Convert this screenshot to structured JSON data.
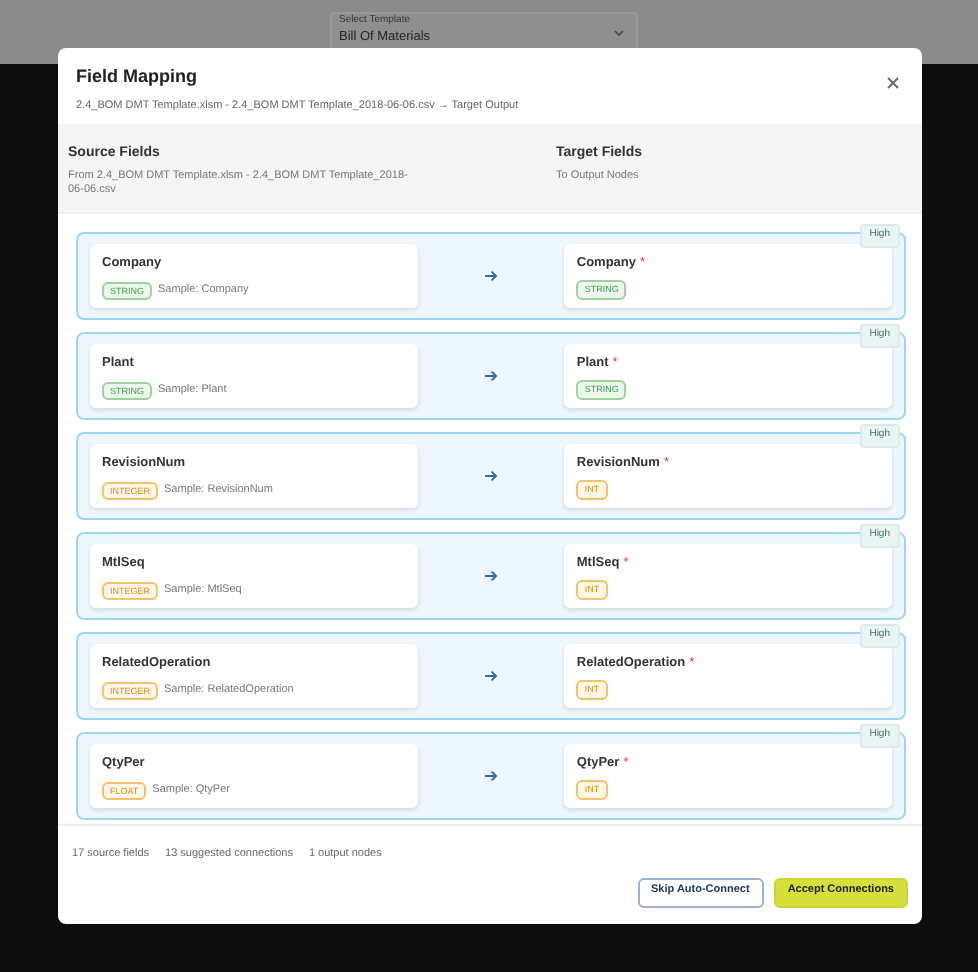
{
  "template_select": {
    "label": "Select Template",
    "value": "Bill Of Materials"
  },
  "modal": {
    "title": "Field Mapping",
    "subtitle": "2.4_BOM DMT Template.xlsm - 2.4_BOM DMT Template_2018-06-06.csv → Target Output",
    "source_header": {
      "title": "Source Fields",
      "description": "From 2.4_BOM DMT Template.xlsm - 2.4_BOM DMT Template_2018-06-06.csv"
    },
    "target_header": {
      "title": "Target Fields",
      "description": "To Output Nodes"
    },
    "mappings": [
      {
        "confidence": "High",
        "source": {
          "name": "Company",
          "type": {
            "text": "STRING",
            "kind": "text"
          },
          "sample": "Sample: Company"
        },
        "target": {
          "name": "Company",
          "required": true,
          "type": {
            "text": "STRING",
            "kind": "text"
          }
        }
      },
      {
        "confidence": "High",
        "source": {
          "name": "Plant",
          "type": {
            "text": "STRING",
            "kind": "text"
          },
          "sample": "Sample: Plant"
        },
        "target": {
          "name": "Plant",
          "required": true,
          "type": {
            "text": "STRING",
            "kind": "text"
          }
        }
      },
      {
        "confidence": "High",
        "source": {
          "name": "RevisionNum",
          "type": {
            "text": "INTEGER",
            "kind": "number"
          },
          "sample": "Sample: RevisionNum"
        },
        "target": {
          "name": "RevisionNum",
          "required": true,
          "type": {
            "text": "INT",
            "kind": "number"
          }
        }
      },
      {
        "confidence": "High",
        "source": {
          "name": "MtlSeq",
          "type": {
            "text": "INTEGER",
            "kind": "number"
          },
          "sample": "Sample: MtlSeq"
        },
        "target": {
          "name": "MtlSeq",
          "required": true,
          "type": {
            "text": "INT",
            "kind": "number"
          }
        }
      },
      {
        "confidence": "High",
        "source": {
          "name": "RelatedOperation",
          "type": {
            "text": "INTEGER",
            "kind": "number"
          },
          "sample": "Sample: RelatedOperation"
        },
        "target": {
          "name": "RelatedOperation",
          "required": true,
          "type": {
            "text": "INT",
            "kind": "number"
          }
        }
      },
      {
        "confidence": "High",
        "source": {
          "name": "QtyPer",
          "type": {
            "text": "FLOAT",
            "kind": "number"
          },
          "sample": "Sample: QtyPer"
        },
        "target": {
          "name": "QtyPer",
          "required": true,
          "type": {
            "text": "INT",
            "kind": "number"
          }
        }
      }
    ],
    "required_mark": "*",
    "stats": [
      "17 source fields",
      "13 suggested connections",
      "1 output nodes"
    ],
    "buttons": [
      {
        "label": "Skip Auto-Connect",
        "kind": "secondary"
      },
      {
        "label": "Accept Connections",
        "kind": "primary"
      }
    ]
  }
}
